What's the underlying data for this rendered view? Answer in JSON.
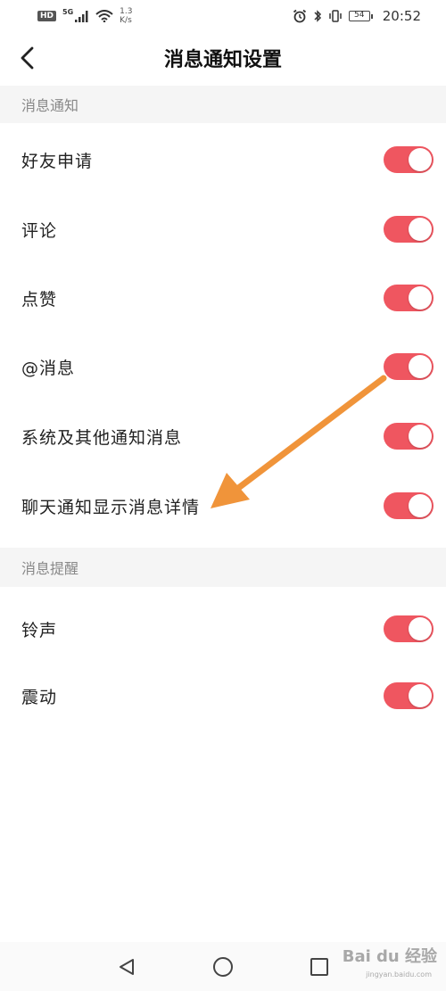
{
  "status_bar": {
    "hd": "HD",
    "network": "5G",
    "speed_value": "1.3",
    "speed_unit": "K/s",
    "battery": "54",
    "time": "20:52",
    "icons": [
      "signal-icon",
      "wifi-icon",
      "alarm-icon",
      "bluetooth-icon",
      "vibrate-icon",
      "battery-icon"
    ]
  },
  "header": {
    "title": "消息通知设置",
    "back_icon": "chevron-left-icon"
  },
  "sections": [
    {
      "title": "消息通知",
      "items": [
        {
          "label": "好友申请",
          "enabled": true
        },
        {
          "label": "评论",
          "enabled": true
        },
        {
          "label": "点赞",
          "enabled": true
        },
        {
          "label": "@消息",
          "enabled": true
        },
        {
          "label": "系统及其他通知消息",
          "enabled": true
        },
        {
          "label": "聊天通知显示消息详情",
          "enabled": true
        }
      ]
    },
    {
      "title": "消息提醒",
      "items": [
        {
          "label": "铃声",
          "enabled": true
        },
        {
          "label": "震动",
          "enabled": true
        }
      ]
    }
  ],
  "nav_bar": {
    "icons": [
      "back-triangle-icon",
      "home-circle-icon",
      "recents-square-icon"
    ]
  },
  "watermark": {
    "text": "Bai du 经验",
    "sub": "jingyan.baidu.com"
  },
  "colors": {
    "toggle_on": "#ef5660",
    "annotation_arrow": "#f0943a",
    "section_bg": "#f5f5f5"
  }
}
